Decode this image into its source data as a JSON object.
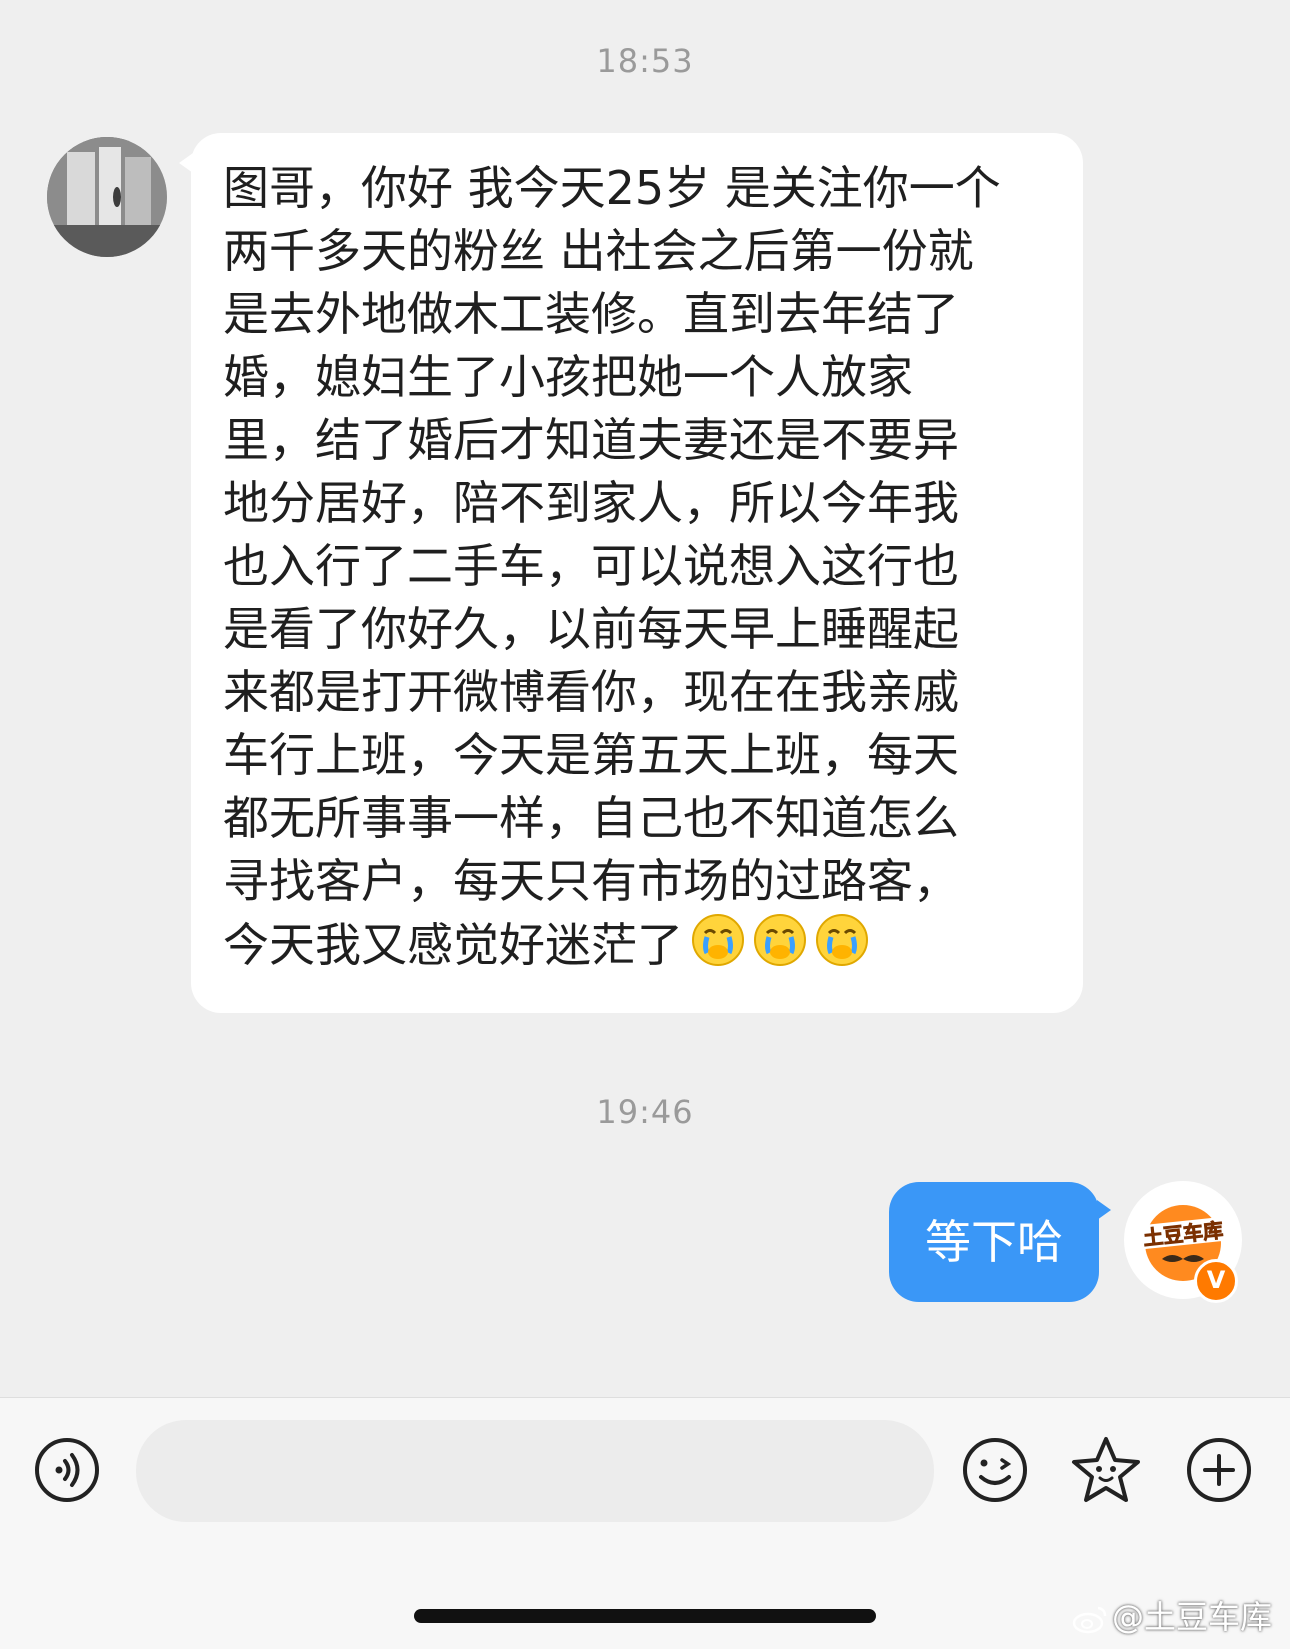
{
  "timestamps": [
    "18:53",
    "19:46"
  ],
  "incoming_message": {
    "lines": [
      "图哥，你好 我今天25岁 是关注你一个",
      "两千多天的粉丝 出社会之后第一份就",
      "是去外地做木工装修。直到去年结了",
      "婚，媳妇生了小孩把她一个人放家",
      "里，结了婚后才知道夫妻还是不要异",
      "地分居好，陪不到家人，所以今年我",
      "也入行了二手车，可以说想入这行也",
      "是看了你好久，以前每天早上睡醒起",
      "来都是打开微博看你，现在在我亲戚",
      "车行上班，今天是第五天上班，每天",
      "都无所事事一样，自己也不知道怎么",
      "寻找客户，每天只有市场的过路客，",
      "今天我又感觉好迷茫了"
    ],
    "emoji": [
      "crying-face-emoji",
      "crying-face-emoji",
      "crying-face-emoji"
    ]
  },
  "outgoing_message": {
    "text": "等下哈"
  },
  "user_avatar": {
    "logo_text": "土豆车库",
    "verified_badge": "V"
  },
  "input_bar": {
    "icons": [
      "voice-icon",
      "emoji-icon",
      "sticker-icon",
      "plus-icon"
    ]
  },
  "watermark": {
    "text": "@土豆车库"
  },
  "colors": {
    "background": "#efefef",
    "incoming_bubble": "#ffffff",
    "outgoing_bubble": "#3a97f7",
    "badge": "#ff7a00"
  }
}
